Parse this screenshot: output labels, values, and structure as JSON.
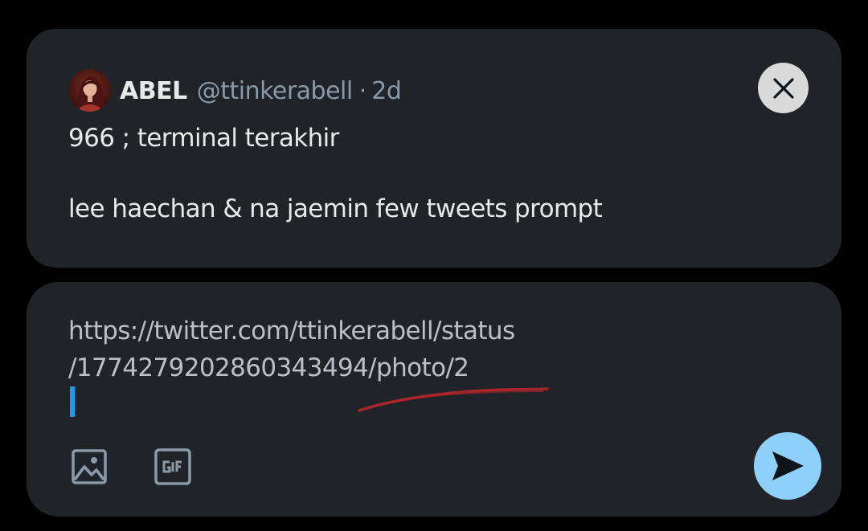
{
  "quoted_post": {
    "author_name": "ABEL",
    "author_handle": "@ttinkerabell",
    "separator": "·",
    "time": "2d",
    "text_line1": "966 ; terminal terakhir",
    "text_line2": "lee haechan & na jaemin few tweets prompt"
  },
  "composer": {
    "text_line1": "https://twitter.com/ttinkerabell/status",
    "text_line2": "/1774279202860343494/photo/2",
    "icons": {
      "image": "image-icon",
      "gif": "gif-icon",
      "send": "send-icon",
      "close": "close-icon"
    }
  },
  "colors": {
    "background": "#000000",
    "card": "#202327",
    "accent": "#1d9bf0",
    "send_button": "#8fd0fb",
    "annotation": "#b3262d"
  }
}
